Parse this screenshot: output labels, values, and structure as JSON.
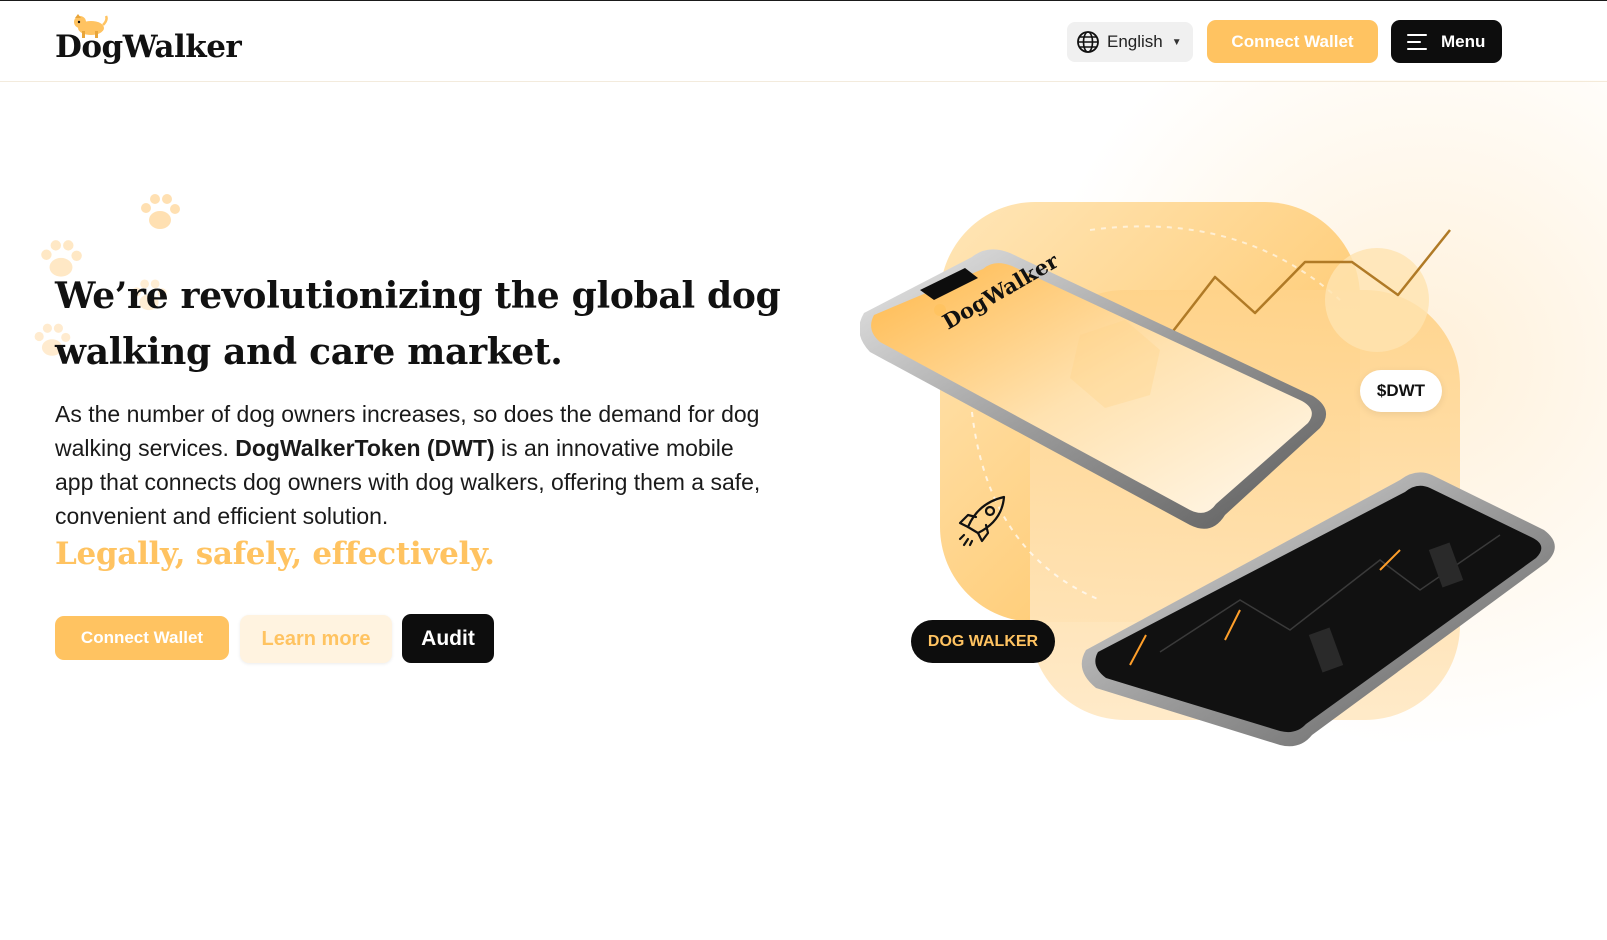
{
  "header": {
    "logo_text": "DogWalker",
    "language": {
      "label": "English",
      "icon": "globe-icon"
    },
    "connect_wallet_label": "Connect Wallet",
    "menu_label": "Menu"
  },
  "hero": {
    "headline": "We’re revolutionizing the global dog walking and care market.",
    "description": {
      "part1": "As the number of dog owners increases, so does the demand for dog walking services. ",
      "emphasis": "DogWalkerToken (DWT)",
      "part2": " is an innovative mobile app that connects dog owners with dog walkers, offering them a safe, convenient and efficient solution."
    },
    "tagline": "Legally, safely, effectively.",
    "buttons": {
      "connect_wallet": "Connect Wallet",
      "learn_more": "Learn more",
      "audit": "Audit"
    }
  },
  "illustration": {
    "token_chip": "$DWT",
    "brand_chip": "DOG WALKER",
    "phone_logo_text": "DogWalker"
  },
  "colors": {
    "accent": "#ffc361",
    "dark": "#0d0d0d",
    "pale_accent": "#fff3e0"
  }
}
